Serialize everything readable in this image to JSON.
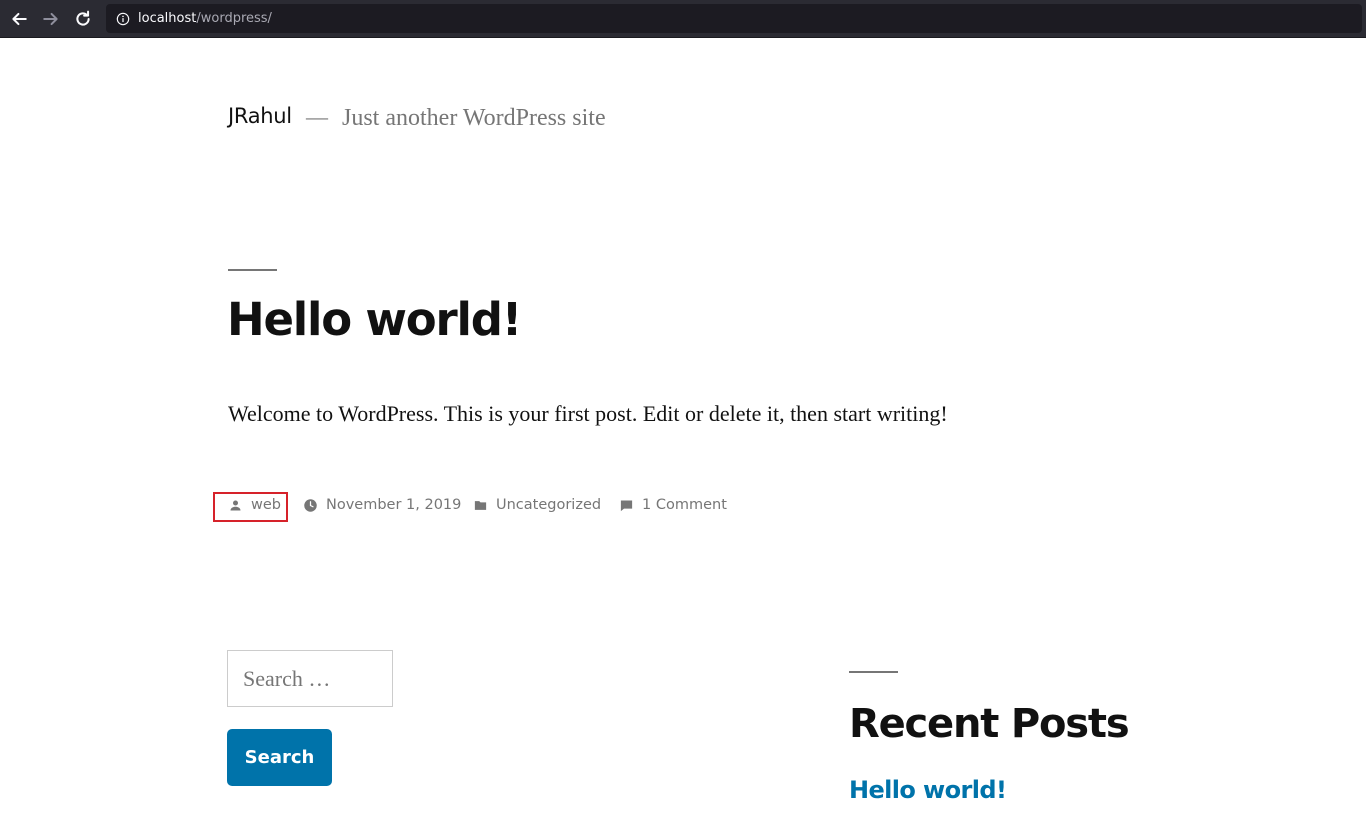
{
  "browser": {
    "url_host": "localhost",
    "url_path": "/wordpress/"
  },
  "site": {
    "title": "JRahul",
    "separator": "—",
    "description": "Just another WordPress site"
  },
  "post": {
    "title": "Hello world!",
    "content": "Welcome to WordPress. This is your first post. Edit or delete it, then start writing!",
    "meta": {
      "author": "web",
      "date": "November 1, 2019",
      "category": "Uncategorized",
      "comments": "1 Comment"
    },
    "highlight_color": "#d6222a"
  },
  "search": {
    "placeholder": "Search …",
    "button_label": "Search"
  },
  "recent_posts": {
    "title": "Recent Posts",
    "items": [
      "Hello world!"
    ]
  },
  "colors": {
    "accent": "#0073aa",
    "text": "#111111",
    "muted": "#767676"
  }
}
